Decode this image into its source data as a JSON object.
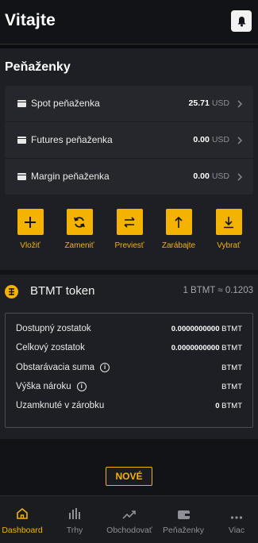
{
  "header": {
    "title": "Vitajte",
    "bell_icon": "bell-icon"
  },
  "wallets": {
    "title": "Peňaženky",
    "items": [
      {
        "name": "Spot peňaženka",
        "value": "25.71",
        "currency": "USD"
      },
      {
        "name": "Futures peňaženka",
        "value": "0.00",
        "currency": "USD"
      },
      {
        "name": "Margin peňaženka",
        "value": "0.00",
        "currency": "USD"
      }
    ]
  },
  "actions": [
    {
      "label": "Vložiť",
      "icon": "plus-icon"
    },
    {
      "label": "Zameniť",
      "icon": "refresh-icon"
    },
    {
      "label": "Previesť",
      "icon": "transfer-icon"
    },
    {
      "label": "Zarábajte",
      "icon": "arrow-up-icon"
    },
    {
      "label": "Vybrať",
      "icon": "download-icon"
    }
  ],
  "token": {
    "name": "BTMT token",
    "rate": "1 BTMT ≈ 0.1203",
    "rows": [
      {
        "label": "Dostupný zostatok",
        "value": "0.0000000000",
        "unit": "BTMT",
        "info": false
      },
      {
        "label": "Celkový zostatok",
        "value": "0.0000000000",
        "unit": "BTMT",
        "info": false
      },
      {
        "label": "Obstarávacia suma",
        "value": "",
        "unit": "BTMT",
        "info": true
      },
      {
        "label": "Výška nároku",
        "value": "",
        "unit": "BTMT",
        "info": true
      },
      {
        "label": "Uzamknuté v zárobku",
        "value": "0",
        "unit": "BTMT",
        "info": false
      }
    ]
  },
  "new_button": {
    "label": "NOVÉ"
  },
  "nav": [
    {
      "label": "Dashboard",
      "icon": "home-icon",
      "active": true
    },
    {
      "label": "Trhy",
      "icon": "bar-chart-icon",
      "active": false
    },
    {
      "label": "Obchodovať",
      "icon": "trend-icon",
      "active": false
    },
    {
      "label": "Peňaženky",
      "icon": "wallet-icon",
      "active": false
    },
    {
      "label": "Viac",
      "icon": "more-icon",
      "active": false
    }
  ],
  "colors": {
    "accent": "#f5b301",
    "background": "#121316",
    "panel": "#1d1f24",
    "card": "#25272d"
  }
}
